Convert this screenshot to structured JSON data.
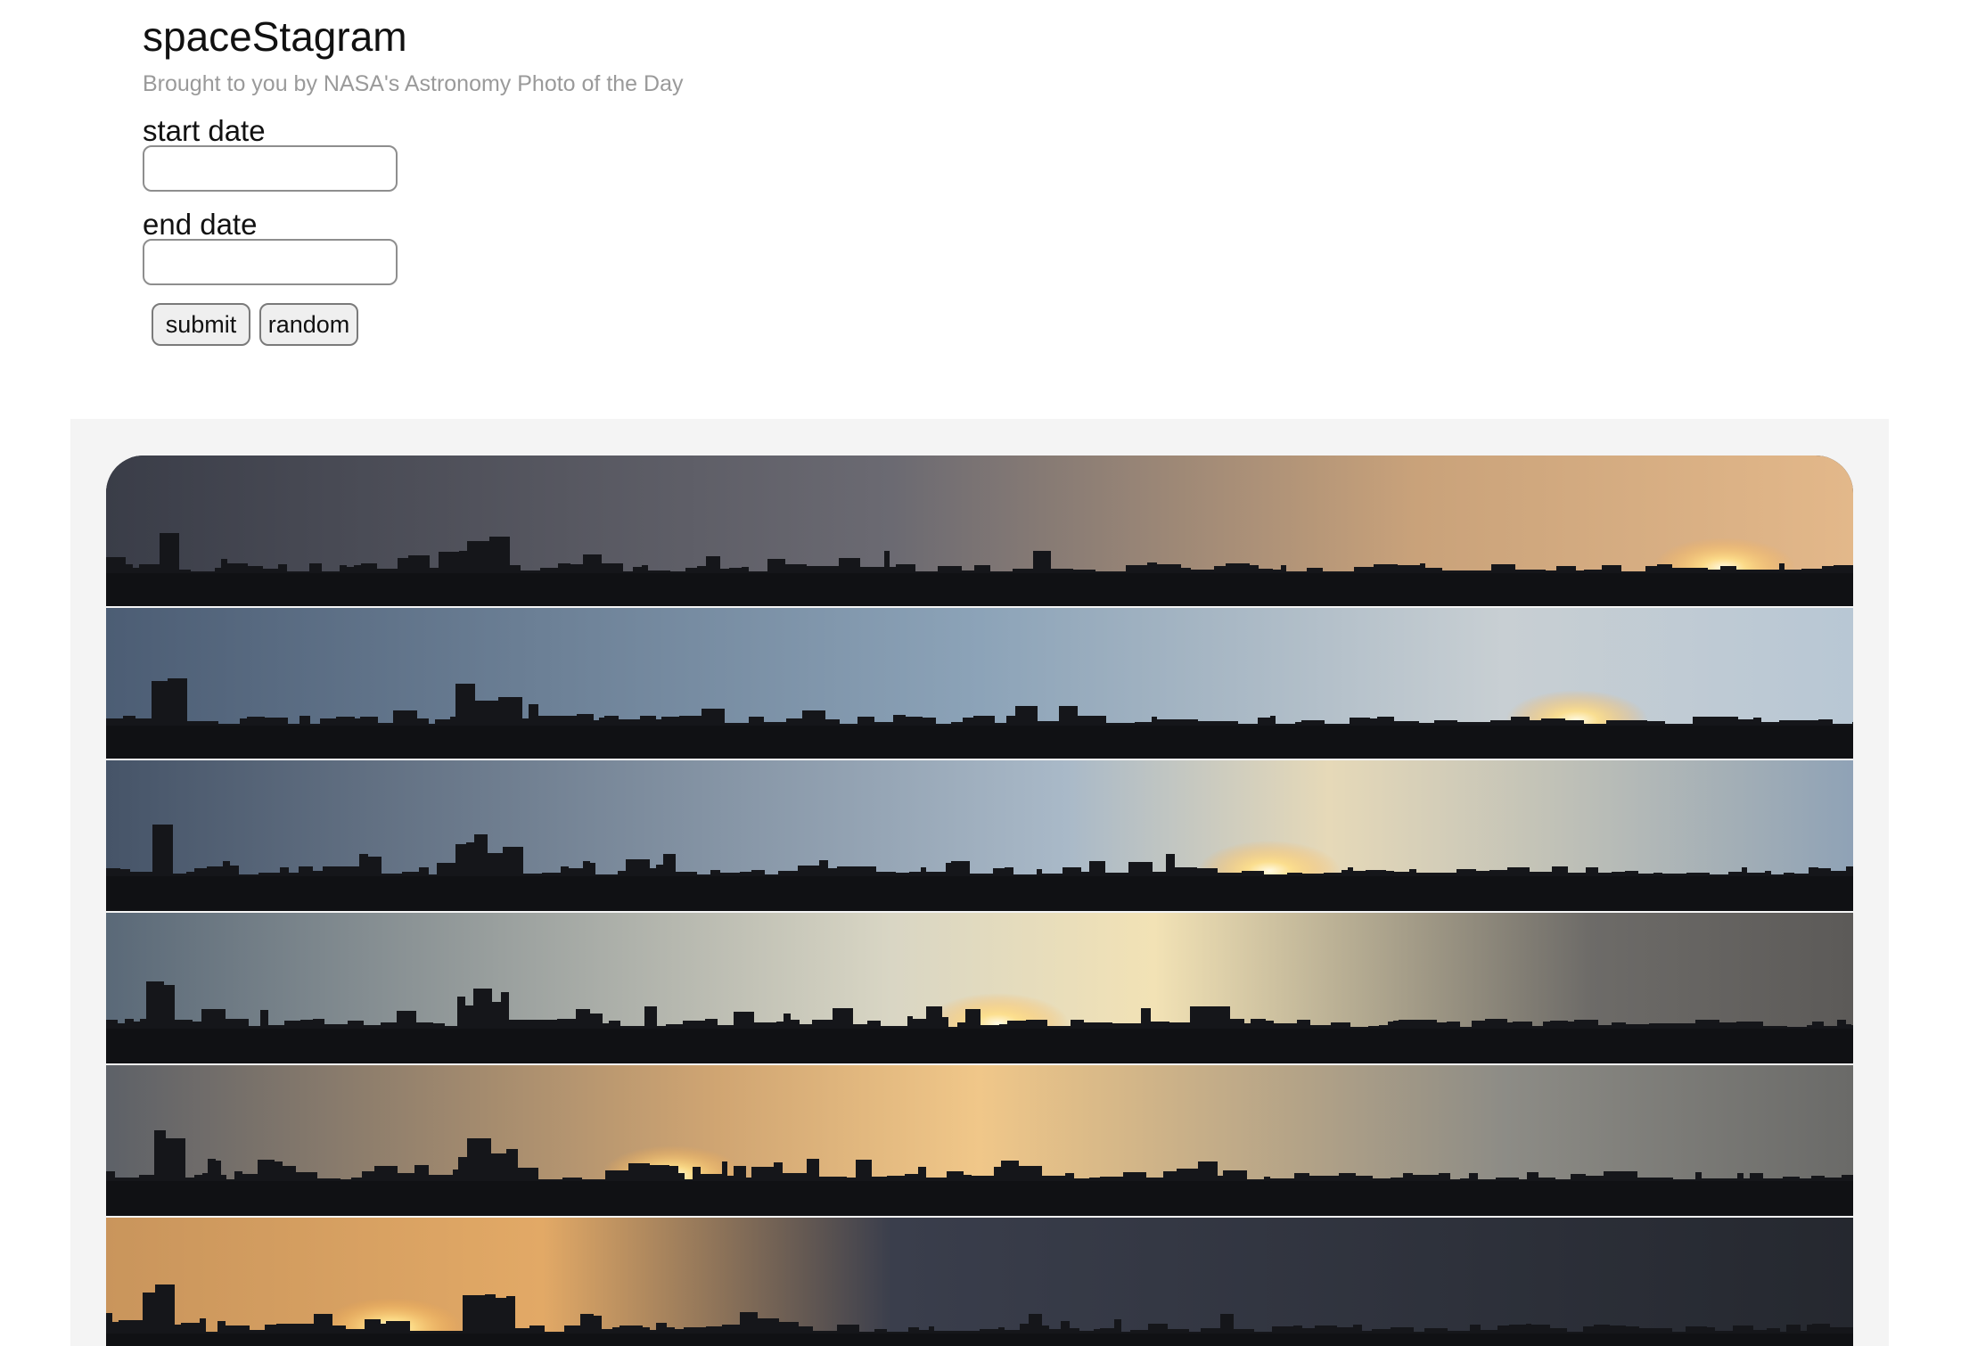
{
  "header": {
    "title": "spaceStagram",
    "subtitle": "Brought to you by NASA's Astronomy Photo of the Day"
  },
  "form": {
    "start_label": "start date",
    "start_value": "",
    "end_label": "end date",
    "end_value": "",
    "submit_label": "submit",
    "random_label": "random"
  },
  "gallery": {
    "photo": {
      "description": "Skyline sunrise/sunset panorama strips",
      "strip_count": 6
    }
  },
  "colors": {
    "subtitle": "#9a9a9a",
    "gallery_bg": "#f4f4f4",
    "button_bg": "#efefef",
    "input_border": "#8e8e8e"
  }
}
